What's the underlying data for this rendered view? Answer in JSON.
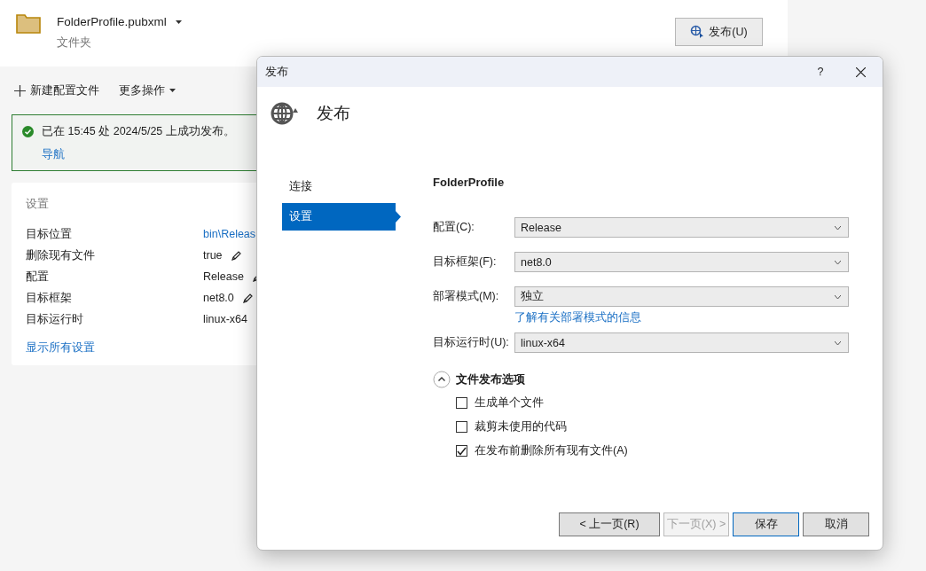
{
  "profile": {
    "name": "FolderProfile.pubxml",
    "subtitle": "文件夹",
    "publish_button": "发布(U)"
  },
  "toolbar": [
    {
      "kind": "add",
      "label": "新建配置文件"
    },
    {
      "kind": "menu",
      "label": "更多操作"
    }
  ],
  "status": {
    "message": "已在 15:45 处 2024/5/25 上成功发布。",
    "link": "导航"
  },
  "settings": {
    "title": "设置",
    "rows": [
      {
        "label": "目标位置",
        "value": "bin\\Releas",
        "kind": "link"
      },
      {
        "label": "删除现有文件",
        "value": "true",
        "kind": "editable"
      },
      {
        "label": "配置",
        "value": "Release",
        "kind": "editable"
      },
      {
        "label": "目标框架",
        "value": "net8.0",
        "kind": "editable"
      },
      {
        "label": "目标运行时",
        "value": "linux-x64",
        "kind": "plain"
      }
    ],
    "show_all": "显示所有设置"
  },
  "dialog": {
    "title": "发布",
    "help": "?",
    "heading": "发布",
    "nav": [
      {
        "label": "连接",
        "selected": false
      },
      {
        "label": "设置",
        "selected": true
      }
    ],
    "profile_name": "FolderProfile",
    "fields": [
      {
        "label": "配置(C):",
        "value": "Release"
      },
      {
        "label": "目标框架(F):",
        "value": "net8.0"
      },
      {
        "label": "部署模式(M):",
        "value": "独立",
        "help_link": "了解有关部署模式的信息"
      },
      {
        "label": "目标运行时(U):",
        "value": "linux-x64"
      }
    ],
    "section": {
      "title": "文件发布选项",
      "expanded": true,
      "options": [
        {
          "label": "生成单个文件",
          "checked": false
        },
        {
          "label": "裁剪未使用的代码",
          "checked": false
        },
        {
          "label": "在发布前删除所有现有文件(A)",
          "checked": true
        }
      ]
    },
    "buttons": [
      {
        "label": "< 上一页(R)",
        "disabled": false,
        "default": false
      },
      {
        "label": "下一页(X) >",
        "disabled": true,
        "default": false
      },
      {
        "label": "保存",
        "disabled": false,
        "default": true
      },
      {
        "label": "取消",
        "disabled": false,
        "default": false
      }
    ]
  }
}
